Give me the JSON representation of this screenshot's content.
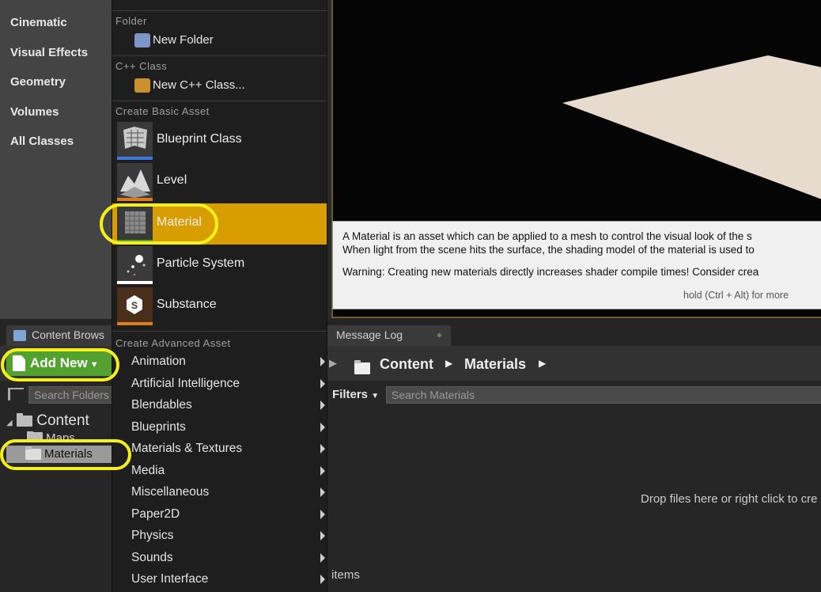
{
  "modes": [
    "Cinematic",
    "Visual Effects",
    "Geometry",
    "Volumes",
    "All Classes"
  ],
  "menu": {
    "folder_header": "Folder",
    "new_folder": "New Folder",
    "cpp_header": "C++ Class",
    "new_cpp": "New C++ Class...",
    "basic_header": "Create Basic Asset",
    "basic_assets": [
      {
        "label": "Blueprint Class",
        "icon": "blueprint-class-icon",
        "bar_color": "#3b78d8"
      },
      {
        "label": "Level",
        "icon": "level-icon",
        "bar_color": "#e07b1a"
      },
      {
        "label": "Material",
        "icon": "material-icon",
        "bar_color": "#5fa82a"
      },
      {
        "label": "Particle System",
        "icon": "particle-system-icon",
        "bar_color": "#ffffff"
      },
      {
        "label": "Substance",
        "icon": "substance-icon",
        "bar_color": "#e07b1a"
      }
    ],
    "advanced_header": "Create Advanced Asset",
    "advanced_assets": [
      "Animation",
      "Artificial Intelligence",
      "Blendables",
      "Blueprints",
      "Materials & Textures",
      "Media",
      "Miscellaneous",
      "Paper2D",
      "Physics",
      "Sounds",
      "User Interface"
    ]
  },
  "tooltip": {
    "line1": "A Material is an asset which can be applied to a mesh to control the visual look of the s",
    "line2": "When light from the scene hits the surface, the shading model of the material is used to",
    "line3": "Warning: Creating new materials directly increases shader compile times!  Consider crea",
    "hold": "hold (Ctrl + Alt) for more"
  },
  "tabs": {
    "content_browser": "Content Brows",
    "message_log": "Message Log"
  },
  "content_browser": {
    "add_new": "Add New",
    "search_folders": "Search Folders",
    "tree": {
      "root": "Content",
      "maps": "Maps",
      "materials": "Materials"
    },
    "path": [
      "Content",
      "Materials"
    ],
    "filters": "Filters",
    "search_placeholder": "Search Materials",
    "drop_hint": "Drop files here or right click to cre",
    "items_label": "items"
  },
  "colors": {
    "selected_highlight": "#d89e00",
    "add_new_green": "#53a12f",
    "annotation_yellow": "#f5ef1a"
  }
}
